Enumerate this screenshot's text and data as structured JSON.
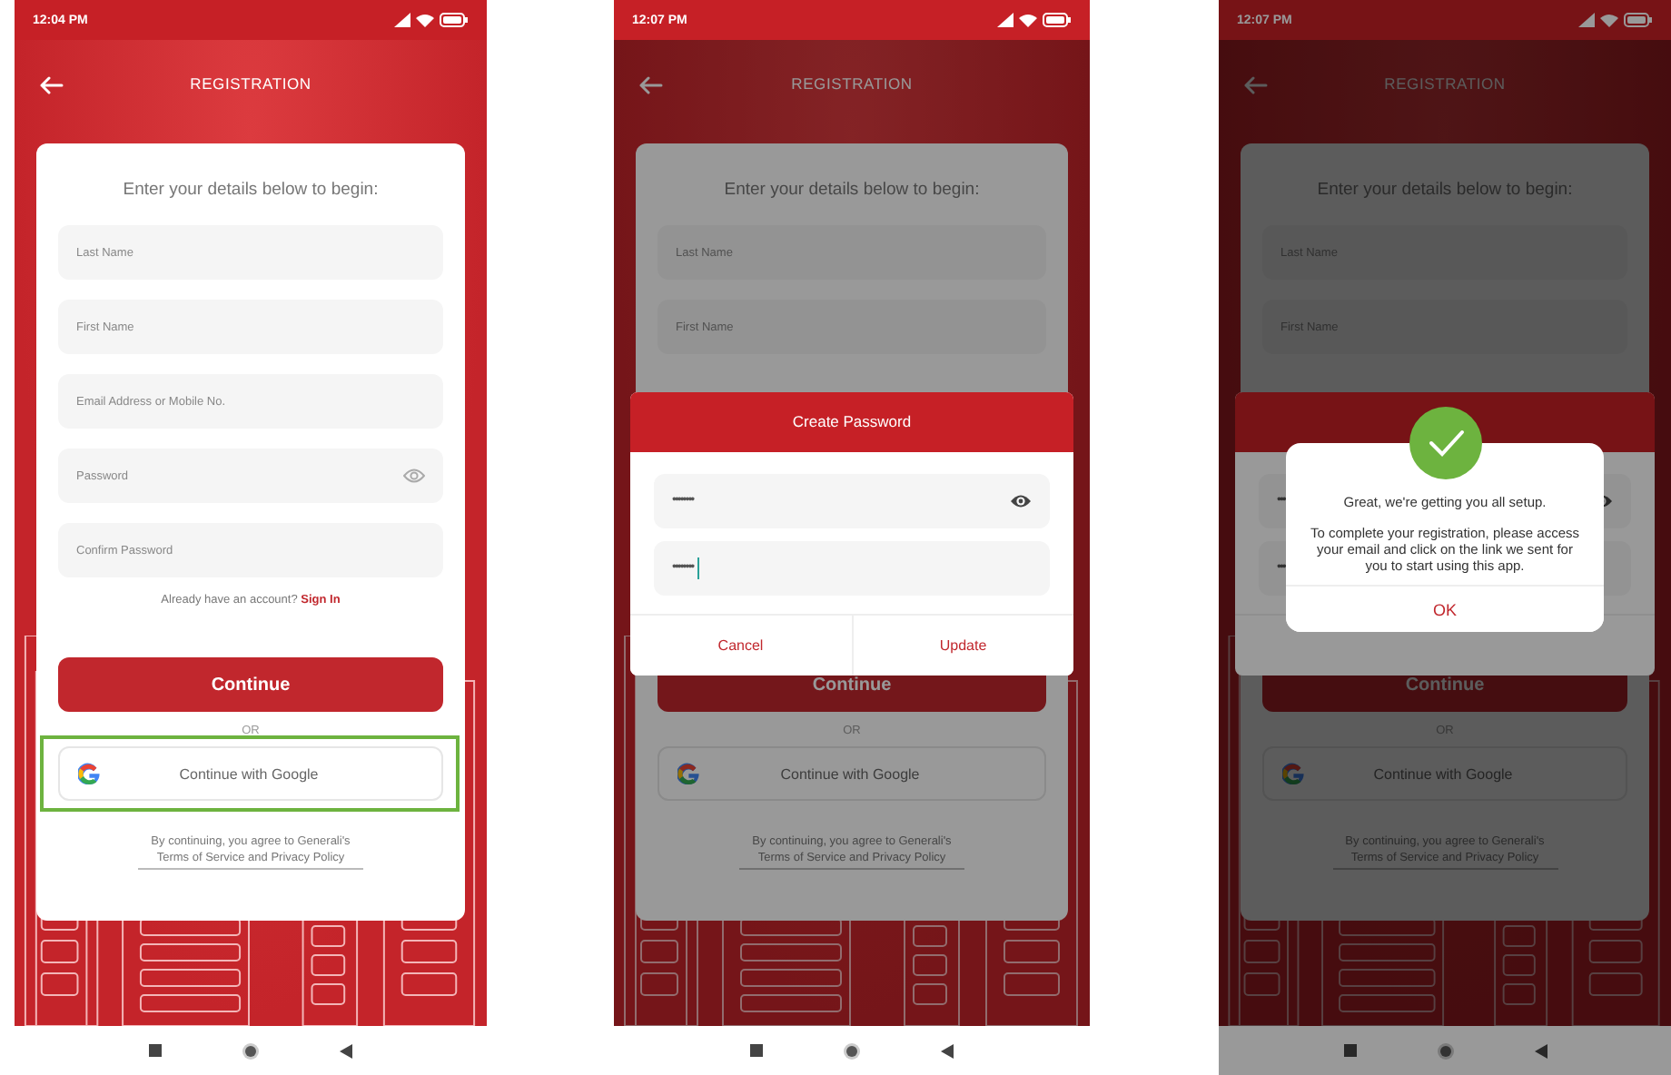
{
  "phones": [
    {
      "status_time": "12:04 PM",
      "title": "REGISTRATION",
      "form": {
        "heading": "Enter your details below to begin:",
        "fields": [
          {
            "placeholder": "Last Name",
            "toggle": false
          },
          {
            "placeholder": "First Name",
            "toggle": false
          },
          {
            "placeholder": "Email Address or Mobile No.",
            "toggle": false
          },
          {
            "placeholder": "Password",
            "toggle": true
          },
          {
            "placeholder": "Confirm Password",
            "toggle": false
          }
        ],
        "sign_in": {
          "prompt": "Already have an account?",
          "link": "Sign In"
        },
        "continue": "Continue",
        "or": "OR",
        "google": {
          "label": "Continue with Google",
          "highlighted": true
        },
        "terms": "By continuing, you agree to Generali's Terms of Service and Privacy Policy"
      }
    },
    {
      "status_time": "12:07 PM",
      "title": "REGISTRATION",
      "form": {
        "heading": "Enter your details below to begin:",
        "fields": [
          {
            "placeholder": "Last Name",
            "toggle": false
          },
          {
            "placeholder": "First Name",
            "toggle": false
          }
        ],
        "continue": "Continue",
        "or": "OR",
        "google": {
          "label": "Continue with Google",
          "highlighted": false
        },
        "terms": "By continuing, you agree to Generali's Terms of Service and Privacy Policy"
      },
      "dialogs": [
        {
          "kind": "password",
          "title": "Create Password",
          "fields": [
            {
              "value": "••••••••",
              "toggle": true,
              "focused": false
            },
            {
              "value": "••••••••",
              "toggle": false,
              "focused": true
            }
          ],
          "buttons": [
            "Cancel",
            "Update"
          ]
        }
      ]
    },
    {
      "status_time": "12:07 PM",
      "title": "REGISTRATION",
      "form": {
        "heading": "Enter your details below to begin:",
        "fields": [
          {
            "placeholder": "Last Name",
            "toggle": false
          },
          {
            "placeholder": "First Name",
            "toggle": false
          }
        ],
        "continue": "Continue",
        "or": "OR",
        "google": {
          "label": "Continue with Google",
          "highlighted": false
        },
        "terms": "By continuing, you agree to Generali's Terms of Service and Privacy Policy"
      },
      "dialogs": [
        {
          "kind": "password",
          "fields": [
            {
              "value": "•••",
              "toggle": true,
              "focused": false
            },
            {
              "value": "•••",
              "toggle": false,
              "focused": false
            }
          ]
        },
        {
          "kind": "success",
          "message": "Great, we're getting you all setup.",
          "body": "To complete your registration, please access your email and click on the link we sent for you to start using this app.",
          "button": "OK"
        }
      ]
    }
  ]
}
